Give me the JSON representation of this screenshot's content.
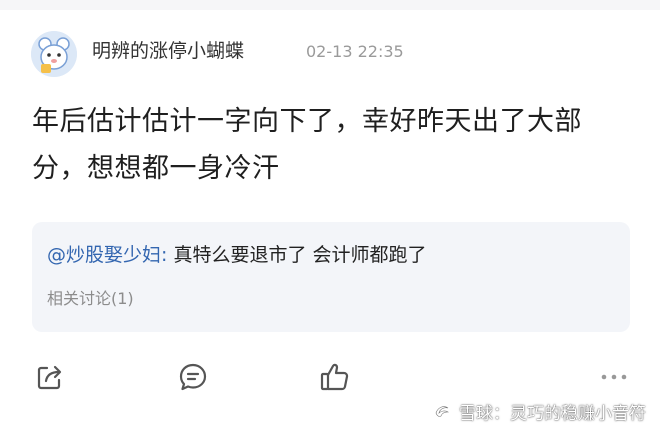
{
  "post": {
    "author": "明辨的涨停小蝴蝶",
    "time": "02-13 22:35",
    "content": "年后估计估计一字向下了，幸好昨天出了大部分，想想都一身冷汗"
  },
  "quote": {
    "user": "@炒股娶少妇:",
    "text": " 真特么要退市了 会计师都跑了",
    "related": "相关讨论(1)"
  },
  "actions": [
    "share-icon",
    "comment-icon",
    "like-icon",
    "more-icon"
  ],
  "watermark": "雪球：灵巧的稳赚小音符",
  "colors": {
    "link": "#3366b0",
    "quote_bg": "#f3f5f9",
    "muted": "#9a9a9a"
  }
}
